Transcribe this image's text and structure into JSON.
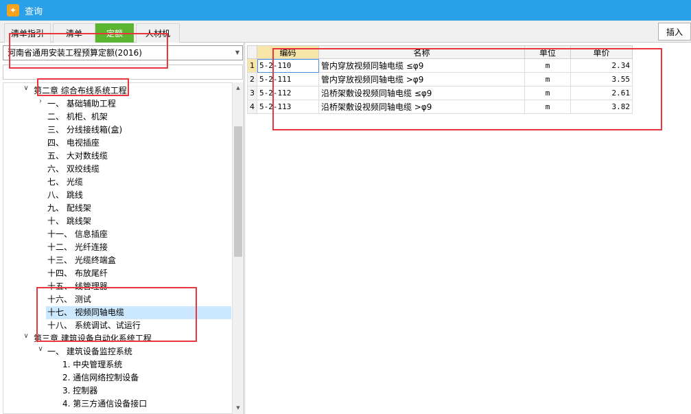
{
  "window": {
    "title": "查询",
    "icon": "app-logo-icon"
  },
  "tabs": [
    {
      "label": "清单指引",
      "active": false
    },
    {
      "label": "清单",
      "active": false
    },
    {
      "label": "定额",
      "active": true
    },
    {
      "label": "人材机",
      "active": false
    }
  ],
  "toolbar": {
    "insert_label": "插入"
  },
  "left": {
    "dropdown_value": "河南省通用安装工程预算定额(2016)",
    "search_value": "",
    "tree": [
      {
        "label": "第二章 综合布线系统工程",
        "toggle": "expanded"
      },
      {
        "label": "一、  基础辅助工程",
        "toggle": "collapsed"
      },
      {
        "label": "二、  机柜、机架",
        "toggle": ""
      },
      {
        "label": "三、  分线接线箱(盒)",
        "toggle": ""
      },
      {
        "label": "四、  电视插座",
        "toggle": ""
      },
      {
        "label": "五、  大对数线缆",
        "toggle": ""
      },
      {
        "label": "六、  双绞线缆",
        "toggle": ""
      },
      {
        "label": "七、  光缆",
        "toggle": ""
      },
      {
        "label": "八、  跳线",
        "toggle": ""
      },
      {
        "label": "九、  配线架",
        "toggle": ""
      },
      {
        "label": "十、  跳线架",
        "toggle": ""
      },
      {
        "label": "十一、  信息插座",
        "toggle": ""
      },
      {
        "label": "十二、  光纤连接",
        "toggle": ""
      },
      {
        "label": "十三、  光缆终端盒",
        "toggle": ""
      },
      {
        "label": "十四、  布放尾纤",
        "toggle": ""
      },
      {
        "label": "十五、  线管理器",
        "toggle": ""
      },
      {
        "label": "十六、  测试",
        "toggle": ""
      },
      {
        "label": "十七、  视频同轴电缆",
        "toggle": "",
        "selected": true
      },
      {
        "label": "十八、  系统调试、试运行",
        "toggle": ""
      },
      {
        "label": "第三章 建筑设备自动化系统工程",
        "toggle": "expanded"
      },
      {
        "label": "一、  建筑设备监控系统",
        "toggle": "expanded"
      },
      {
        "label": "1. 中央管理系统",
        "toggle": ""
      },
      {
        "label": "2. 通信网络控制设备",
        "toggle": ""
      },
      {
        "label": "3. 控制器",
        "toggle": ""
      },
      {
        "label": "4. 第三方通信设备接口",
        "toggle": ""
      }
    ]
  },
  "grid": {
    "headers": [
      "编码",
      "名称",
      "单位",
      "单价"
    ],
    "rows": [
      {
        "n": "1",
        "code": "5-2-110",
        "name": "管内穿放视频同轴电缆 ≤φ9",
        "unit": "m",
        "price": "2.34"
      },
      {
        "n": "2",
        "code": "5-2-111",
        "name": "管内穿放视频同轴电缆 >φ9",
        "unit": "m",
        "price": "3.55"
      },
      {
        "n": "3",
        "code": "5-2-112",
        "name": "沿桥架敷设视频同轴电缆 ≤φ9",
        "unit": "m",
        "price": "2.61"
      },
      {
        "n": "4",
        "code": "5-2-113",
        "name": "沿桥架敷设视频同轴电缆 >φ9",
        "unit": "m",
        "price": "3.82"
      }
    ]
  },
  "colors": {
    "titlebar": "#2aa0e8",
    "active_tab": "#5cb531",
    "annotation": "#e8343a",
    "selection": "#cce8ff"
  }
}
